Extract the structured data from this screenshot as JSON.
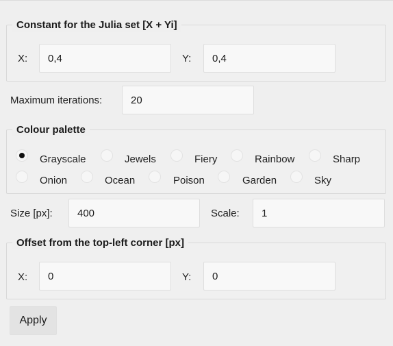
{
  "julia_constant": {
    "legend": "Constant for the Julia set [X + Yi]",
    "x_label": "X:",
    "x_value": "0,4",
    "y_label": "Y:",
    "y_value": "0,4"
  },
  "max_iterations": {
    "label": "Maximum iterations:",
    "value": "20"
  },
  "palette": {
    "legend": "Colour palette",
    "selected": "Grayscale",
    "options": [
      {
        "label": "Grayscale",
        "checked": true
      },
      {
        "label": "Jewels",
        "checked": false
      },
      {
        "label": "Fiery",
        "checked": false
      },
      {
        "label": "Rainbow",
        "checked": false
      },
      {
        "label": "Sharp",
        "checked": false
      },
      {
        "label": "Onion",
        "checked": false
      },
      {
        "label": "Ocean",
        "checked": false
      },
      {
        "label": "Poison",
        "checked": false
      },
      {
        "label": "Garden",
        "checked": false
      },
      {
        "label": "Sky",
        "checked": false
      }
    ]
  },
  "size": {
    "label": "Size [px]:",
    "value": "400"
  },
  "scale": {
    "label": "Scale:",
    "value": "1"
  },
  "offset": {
    "legend": "Offset from the top-left corner [px]",
    "x_label": "X:",
    "x_value": "0",
    "y_label": "Y:",
    "y_value": "0"
  },
  "apply_button": "Apply"
}
